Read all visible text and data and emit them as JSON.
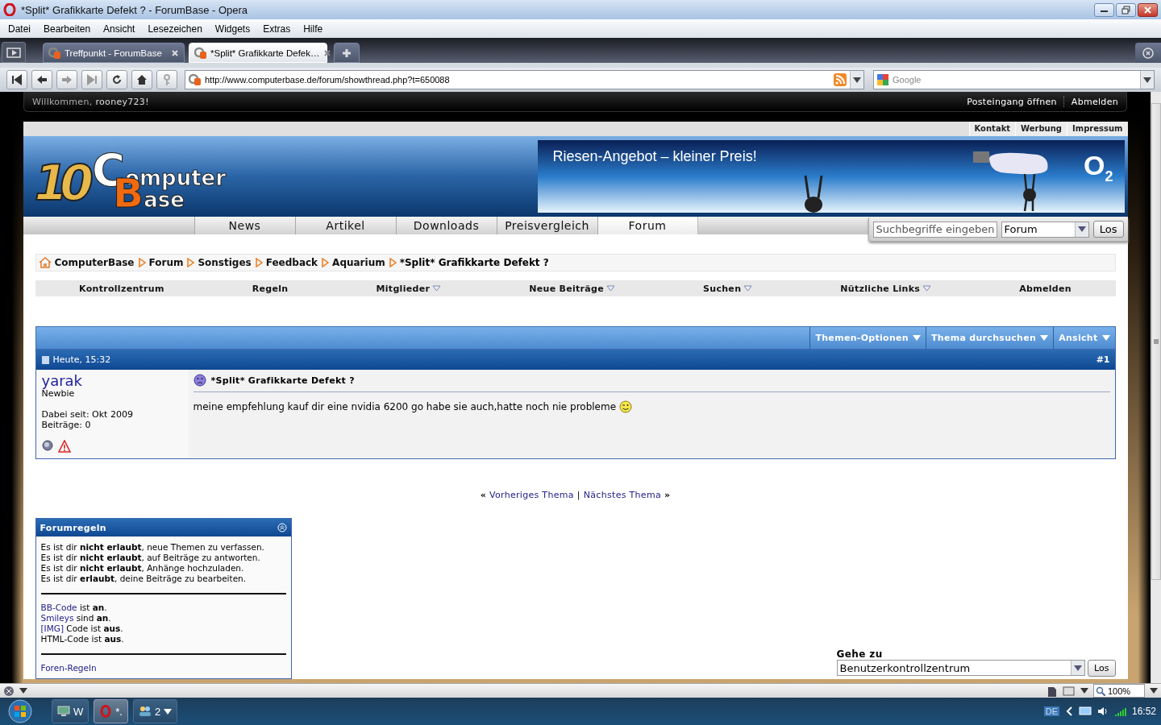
{
  "window": {
    "title": "*Split* Grafikkarte Defekt ? - ForumBase - Opera"
  },
  "menu": [
    "Datei",
    "Bearbeiten",
    "Ansicht",
    "Lesezeichen",
    "Widgets",
    "Extras",
    "Hilfe"
  ],
  "tabs": [
    {
      "label": "Treffpunkt - ForumBase",
      "selected": false
    },
    {
      "label": "*Split* Grafikkarte Defek…",
      "selected": true
    }
  ],
  "address_bar": {
    "url": "http://www.computerbase.de/forum/showthread.php?t=650088"
  },
  "search_bar": {
    "placeholder": "Google"
  },
  "page": {
    "welcome": {
      "greeting": "Willkommen,",
      "user": "rooney723!"
    },
    "user_links": [
      "Posteingang öffnen",
      "Abmelden"
    ],
    "top_links": [
      "Kontakt",
      "Werbung",
      "Impressum"
    ],
    "logo": {
      "number": "10",
      "word1": "Computer",
      "word2": "Base"
    },
    "ad": {
      "headline": "Riesen-Angebot – kleiner Preis!",
      "brand": "O$_{2}$"
    },
    "nav": [
      {
        "label": "News",
        "selected": false
      },
      {
        "label": "Artikel",
        "selected": false
      },
      {
        "label": "Downloads",
        "selected": false
      },
      {
        "label": "Preisvergleich",
        "selected": false
      },
      {
        "label": "Forum",
        "selected": true
      }
    ],
    "site_search": {
      "placeholder": "Suchbegriffe eingeben",
      "scope": "Forum",
      "button": "Los"
    },
    "breadcrumb": [
      "ComputerBase",
      "Forum",
      "Sonstiges",
      "Feedback",
      "Aquarium"
    ],
    "current": "*Split* Grafikkarte Defekt ?",
    "navbar": [
      {
        "label": "Kontrollzentrum",
        "dropdown": false
      },
      {
        "label": "Regeln",
        "dropdown": false
      },
      {
        "label": "Mitglieder",
        "dropdown": true
      },
      {
        "label": "Neue Beiträge",
        "dropdown": true
      },
      {
        "label": "Suchen",
        "dropdown": true
      },
      {
        "label": "Nützliche Links",
        "dropdown": true
      },
      {
        "label": "Abmelden",
        "dropdown": false
      }
    ],
    "thread_tools": [
      "Themen-Optionen",
      "Thema durchsuchen",
      "Ansicht"
    ],
    "post": {
      "date": "Heute, 15:32",
      "number": "#1",
      "author": "yarak",
      "rank": "Newbie",
      "joined": "Dabei seit: Okt 2009",
      "posts": "Beiträge: 0",
      "title": "*Split* Grafikkarte Defekt ?",
      "message": "meine empfehlung kauf dir eine nvidia 6200 go habe sie auch,hatte noch nie probleme"
    },
    "thread_nav": {
      "prev_marker": "«",
      "prev": "Vorheriges Thema",
      "separator": "|",
      "next": "Nächstes Thema",
      "next_marker": "»"
    },
    "forum_rules": {
      "title": "Forumregeln",
      "permissions": [
        "Es ist dir **nicht erlaubt**, neue Themen zu verfassen.",
        "Es ist dir **nicht erlaubt**, auf Beiträge zu antworten.",
        "Es ist dir **nicht erlaubt**, Anhänge hochzuladen.",
        "Es ist dir **erlaubt**, deine Beiträge zu bearbeiten."
      ],
      "settings": [
        {
          "link": "BB-Code",
          "text": "ist **an**."
        },
        {
          "link": "Smileys",
          "text": "sind **an**."
        },
        {
          "link": "[IMG]",
          "text": "Code ist **aus**."
        },
        {
          "text": "HTML-Code ist **aus**."
        }
      ],
      "link": "Foren-Regeln"
    },
    "goto": {
      "label": "Gehe zu",
      "value": "Benutzerkontrollzentrum",
      "button": "Los"
    }
  },
  "status_bar": {
    "zoom": "100%"
  },
  "taskbar": {
    "items": [
      {
        "label": "W",
        "selected": false
      },
      {
        "label": "*.",
        "selected": true
      },
      {
        "label": "2",
        "selected": false
      }
    ],
    "language": "DE",
    "clock": "16:52"
  }
}
